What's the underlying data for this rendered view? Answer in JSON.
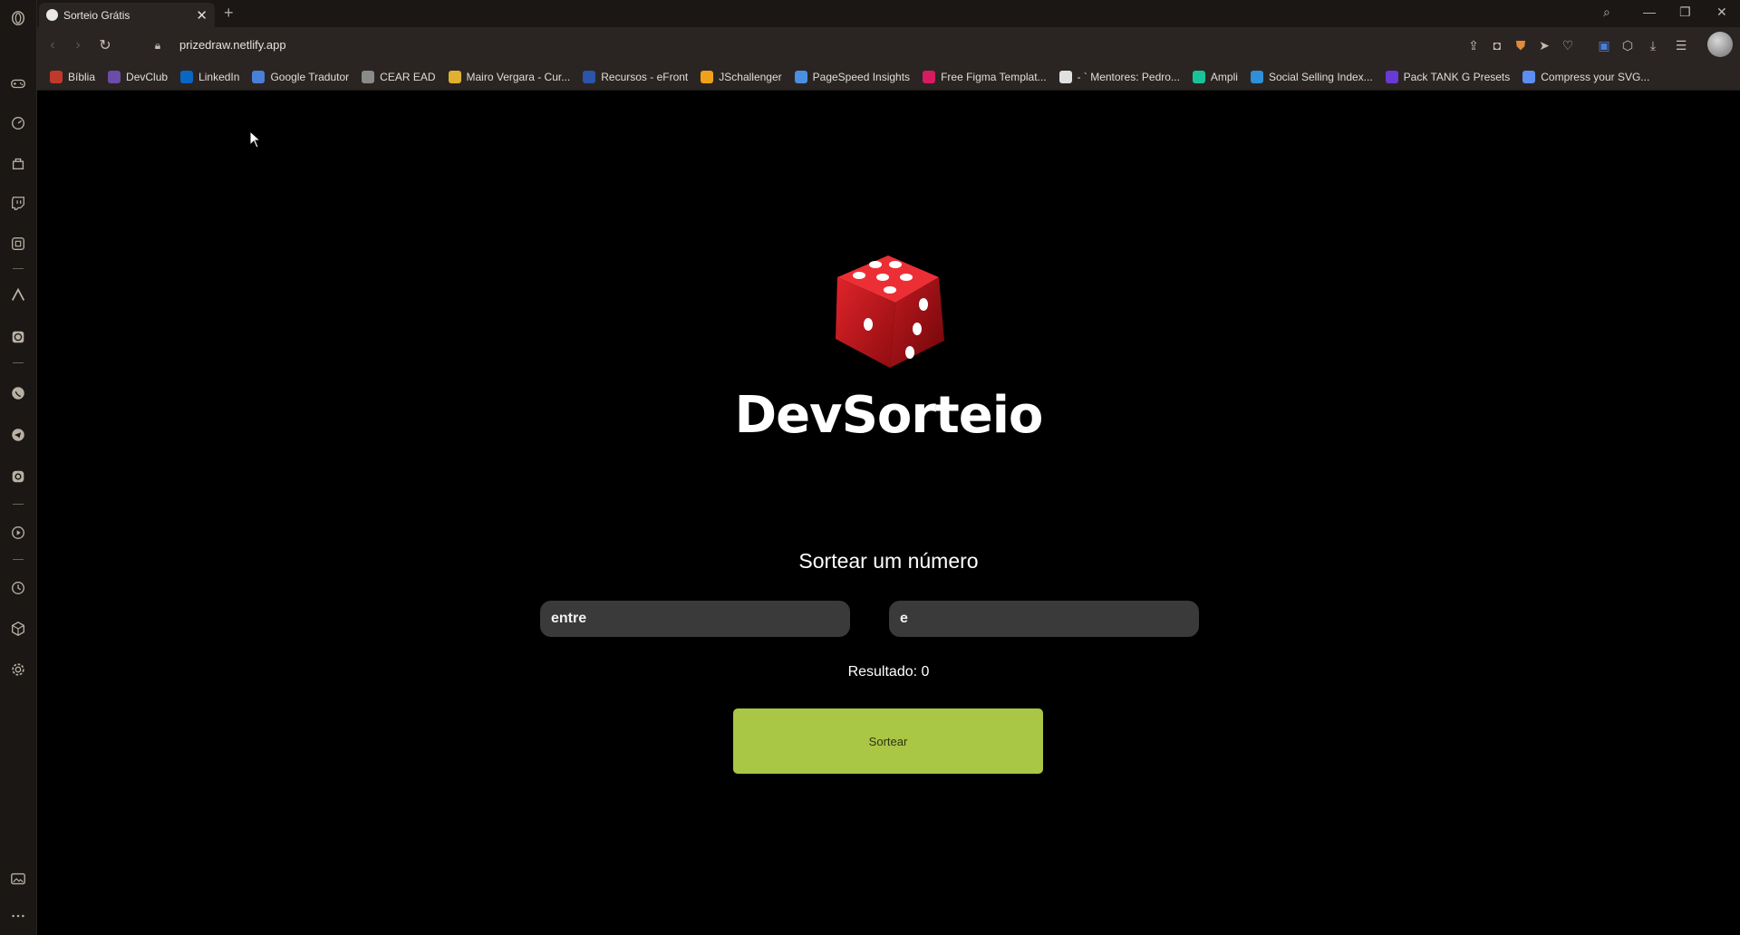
{
  "browser": {
    "tab_title": "Sorteio Grátis",
    "url": "prizedraw.netlify.app",
    "bookmarks": [
      {
        "label": "Bíblia",
        "color": "#c0392b"
      },
      {
        "label": "DevClub",
        "color": "#6b4ca8"
      },
      {
        "label": "LinkedIn",
        "color": "#0a66c2"
      },
      {
        "label": "Google Tradutor",
        "color": "#4a7fd8"
      },
      {
        "label": "CEAR EAD",
        "color": "#8a8a8a"
      },
      {
        "label": "Mairo Vergara - Cur...",
        "color": "#e0b030"
      },
      {
        "label": "Recursos - eFront",
        "color": "#2a55a8"
      },
      {
        "label": "JSchallenger",
        "color": "#f0a11a"
      },
      {
        "label": "PageSpeed Insights",
        "color": "#4a8fe0"
      },
      {
        "label": "Free Figma Templat...",
        "color": "#d81b60"
      },
      {
        "label": "- ` Mentores: Pedro...",
        "color": "#e0e0e0"
      },
      {
        "label": "Ampli",
        "color": "#19c39a"
      },
      {
        "label": "Social Selling Index...",
        "color": "#2f8fd8"
      },
      {
        "label": "Pack TANK G Presets",
        "color": "#6a3ad8"
      },
      {
        "label": "Compress your SVG...",
        "color": "#5b8ef0"
      }
    ]
  },
  "app": {
    "brand": "DevSorteio",
    "subtitle": "Sortear um número",
    "min_placeholder": "entre",
    "max_placeholder": "e",
    "result_label": "Resultado: 0",
    "button_label": "Sortear",
    "accent_color": "#a9c645"
  }
}
